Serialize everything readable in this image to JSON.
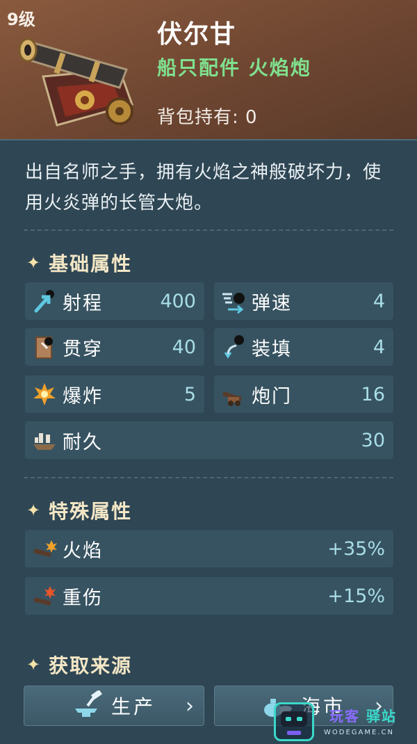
{
  "item": {
    "level": "9级",
    "name": "伏尔甘",
    "type": "船只配件 火焰炮",
    "owned": "背包持有: 0",
    "description": "出自名师之手，拥有火焰之神般破坏力，使用火炎弹的长管大炮。"
  },
  "basic": {
    "title": "基础属性",
    "stats": [
      {
        "label": "射程",
        "value": "400",
        "icon": "range-arrow-icon"
      },
      {
        "label": "弹速",
        "value": "4",
        "icon": "cannonball-speed-icon"
      },
      {
        "label": "贯穿",
        "value": "40",
        "icon": "pierce-icon"
      },
      {
        "label": "装填",
        "value": "4",
        "icon": "reload-icon"
      },
      {
        "label": "爆炸",
        "value": "5",
        "icon": "explosion-icon"
      },
      {
        "label": "炮门",
        "value": "16",
        "icon": "cannon-icon"
      },
      {
        "label": "耐久",
        "value": "30",
        "icon": "ship-icon"
      }
    ]
  },
  "special": {
    "title": "特殊属性",
    "stats": [
      {
        "label": "火焰",
        "value": "+35%",
        "icon": "fire-cannon-icon"
      },
      {
        "label": "重伤",
        "value": "+15%",
        "icon": "heavy-wound-cannon-icon"
      }
    ]
  },
  "source": {
    "title": "获取来源",
    "buttons": [
      {
        "label": "生产",
        "icon": "anvil-hammer-icon"
      },
      {
        "label": "海市",
        "icon": "money-bag-icon"
      }
    ]
  },
  "watermark": {
    "brand_a": "玩客",
    "brand_b": "驿站",
    "url": "WODEGAME.CN"
  },
  "colors": {
    "header_bg": "#6e4631",
    "panel_bg": "#2f4654",
    "stat_bg": "#375361",
    "type_green": "#7fe08e",
    "value_cyan": "#a9dde8"
  }
}
